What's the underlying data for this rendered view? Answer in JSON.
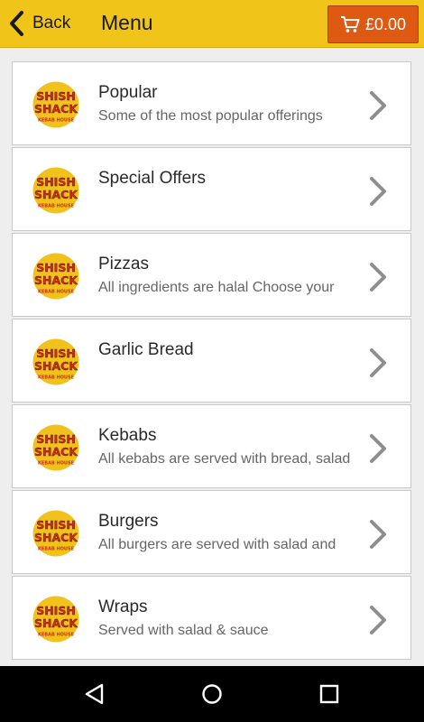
{
  "header": {
    "back_label": "Back",
    "title": "Menu",
    "cart_total": "£0.00"
  },
  "menu": {
    "items": [
      {
        "name": "Popular",
        "desc": "Some of the most popular offerings"
      },
      {
        "name": "Special Offers",
        "desc": ""
      },
      {
        "name": "Pizzas",
        "desc": "All ingredients are halal Choose your"
      },
      {
        "name": "Garlic Bread",
        "desc": ""
      },
      {
        "name": "Kebabs",
        "desc": "All kebabs are served with bread, salad"
      },
      {
        "name": "Burgers",
        "desc": "All burgers are served with salad and"
      },
      {
        "name": "Wraps",
        "desc": "Served with salad & sauce"
      }
    ]
  },
  "logo_text": [
    "SHISH",
    "SHACK",
    "KEBAB HOUSE"
  ],
  "icons": {
    "back": "chevron-left-icon",
    "cart": "shopping-cart-icon",
    "item_chevron": "chevron-right-icon",
    "nav": [
      "back-triangle-icon",
      "home-circle-icon",
      "recents-square-icon"
    ]
  },
  "colors": {
    "header_bg": "#f0c419",
    "cart_bg": "#de5a12",
    "logo_bg": "#f2c21c",
    "logo_text": "#d22a1c"
  }
}
